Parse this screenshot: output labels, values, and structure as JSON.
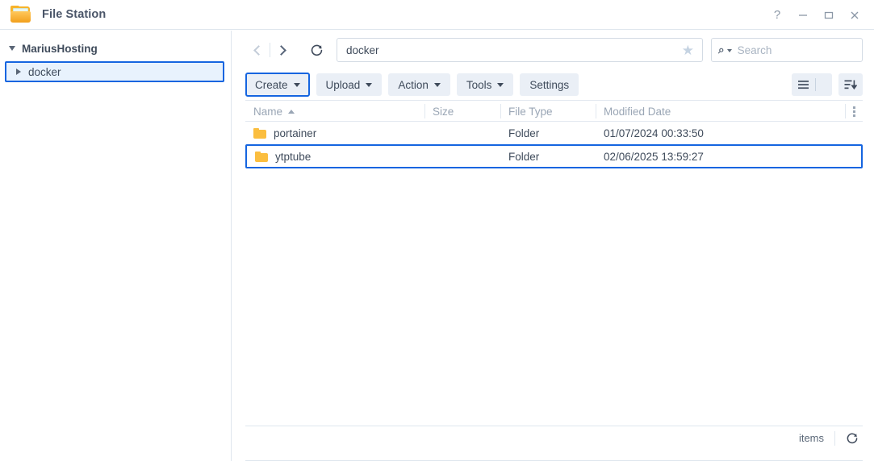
{
  "window": {
    "title": "File Station",
    "app_icon": "folder-icon",
    "controls": {
      "help": "?",
      "minimize": "minimize-icon",
      "maximize": "maximize-icon",
      "close": "close-icon"
    }
  },
  "sidebar": {
    "root": {
      "label": "MariusHosting",
      "expanded": true
    },
    "items": [
      {
        "label": "docker",
        "expanded": false,
        "selected": true
      }
    ]
  },
  "navbar": {
    "back": "back-arrow",
    "forward": "forward-arrow",
    "back_disabled": true,
    "refresh": "refresh-icon",
    "path_value": "docker",
    "path_placeholder": "",
    "favorite_icon": "star-icon",
    "search": {
      "icon": "search-icon",
      "placeholder": "Search",
      "value": ""
    }
  },
  "toolbar": {
    "buttons": [
      {
        "label": "Create",
        "has_caret": true,
        "focused": true
      },
      {
        "label": "Upload",
        "has_caret": true,
        "focused": false
      },
      {
        "label": "Action",
        "has_caret": true,
        "focused": false
      },
      {
        "label": "Tools",
        "has_caret": true,
        "focused": false
      },
      {
        "label": "Settings",
        "has_caret": false,
        "focused": false
      }
    ],
    "view_icon": "list-view-icon",
    "view_caret": "chevron-down-icon",
    "sort_icon": "sort-descending-icon"
  },
  "file_list": {
    "columns": [
      {
        "key": "name",
        "label": "Name",
        "sorted": "asc"
      },
      {
        "key": "size",
        "label": "Size",
        "sorted": ""
      },
      {
        "key": "type",
        "label": "File Type",
        "sorted": ""
      },
      {
        "key": "modified",
        "label": "Modified Date",
        "sorted": ""
      }
    ],
    "column_menu_icon": "more-options-icon",
    "rows": [
      {
        "icon": "folder-icon",
        "name": "portainer",
        "size": "",
        "type": "Folder",
        "modified": "01/07/2024 00:33:50",
        "selected": false
      },
      {
        "icon": "folder-icon",
        "name": "ytptube",
        "size": "",
        "type": "Folder",
        "modified": "02/06/2025 13:59:27",
        "selected": true
      }
    ]
  },
  "statusbar": {
    "items_label": "items",
    "refresh_icon": "refresh-icon"
  },
  "colors": {
    "accent": "#1565e0",
    "folder": "#fbbe3f",
    "text": "#3f4b5b",
    "muted": "#9aa6b5",
    "border": "#dfe6ee",
    "button_bg": "#eaeff6",
    "selected_bg": "#e8f2fd"
  }
}
